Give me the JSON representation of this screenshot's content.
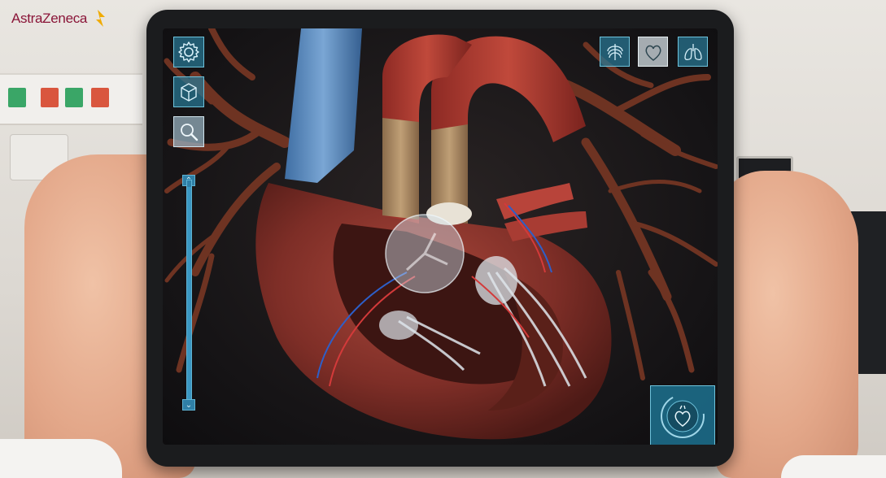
{
  "brand": {
    "name": "AstraZeneca",
    "color": "#8a1538",
    "mark_color": "#f0ab00"
  },
  "app": {
    "accent": "#2f8db5",
    "left_toolbar": [
      {
        "id": "settings",
        "icon": "gear-icon"
      },
      {
        "id": "3d-view",
        "icon": "cube-icon"
      },
      {
        "id": "zoom",
        "icon": "magnifier-icon"
      }
    ],
    "zoom_slider": {
      "level": 0.97,
      "min_icon": "chevron-down-icon",
      "max_icon": "chevron-up-icon"
    },
    "view_modes": [
      {
        "id": "ribcage",
        "icon": "ribcage-icon",
        "active": false
      },
      {
        "id": "heart",
        "icon": "heart-icon",
        "active": true
      },
      {
        "id": "lungs",
        "icon": "lungs-icon",
        "active": false
      }
    ],
    "heart_badge": {
      "icon": "heart-rotate-icon"
    }
  }
}
